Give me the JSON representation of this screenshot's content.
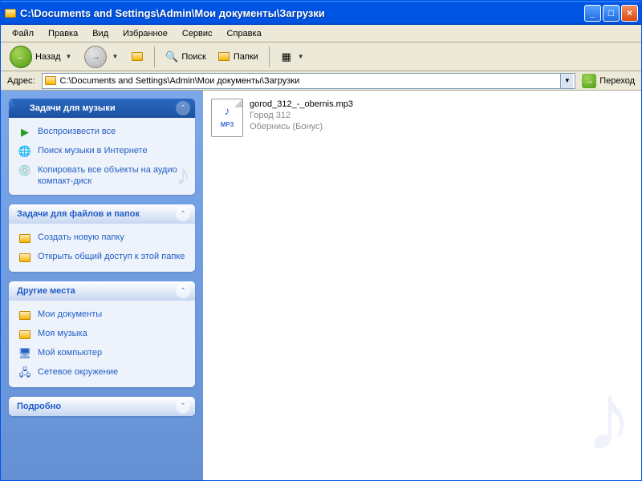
{
  "window": {
    "title": "C:\\Documents and Settings\\Admin\\Мои документы\\Загрузки"
  },
  "menu": {
    "file": "Файл",
    "edit": "Правка",
    "view": "Вид",
    "favorites": "Избранное",
    "tools": "Сервис",
    "help": "Справка"
  },
  "toolbar": {
    "back": "Назад",
    "search": "Поиск",
    "folders": "Папки"
  },
  "address": {
    "label": "Адрес:",
    "value": "C:\\Documents and Settings\\Admin\\Мои документы\\Загрузки",
    "go": "Переход"
  },
  "panels": {
    "music": {
      "title": "Задачи для музыки",
      "tasks": {
        "play_all": "Воспроизвести все",
        "search_online": "Поиск музыки в Интернете",
        "copy_cd": "Копировать все объекты на аудио компакт-диск"
      }
    },
    "files": {
      "title": "Задачи для файлов и папок",
      "tasks": {
        "new_folder": "Создать новую папку",
        "share": "Открыть общий доступ к этой папке"
      }
    },
    "places": {
      "title": "Другие места",
      "tasks": {
        "documents": "Мои документы",
        "music": "Моя музыка",
        "computer": "Мой компьютер",
        "network": "Сетевое окружение"
      }
    },
    "details": {
      "title": "Подробно"
    }
  },
  "file": {
    "name": "gorod_312_-_obernis.mp3",
    "artist": "Город 312",
    "title": "Обернись (Бонус)",
    "type_label": "MP3"
  }
}
